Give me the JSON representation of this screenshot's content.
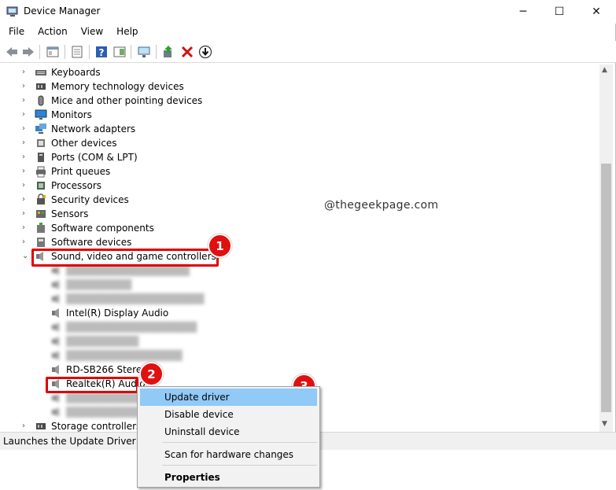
{
  "window": {
    "title": "Device Manager",
    "minimize_glyph": "─",
    "maximize_glyph": "☐",
    "close_glyph": "✕"
  },
  "menu": [
    "File",
    "Action",
    "View",
    "Help"
  ],
  "tree": {
    "items": [
      {
        "label": "Keyboards",
        "icon": "keyboard-icon",
        "expanded": false
      },
      {
        "label": "Memory technology devices",
        "icon": "memory-icon",
        "expanded": false
      },
      {
        "label": "Mice and other pointing devices",
        "icon": "mouse-icon",
        "expanded": false
      },
      {
        "label": "Monitors",
        "icon": "monitor-icon",
        "expanded": false
      },
      {
        "label": "Network adapters",
        "icon": "network-icon",
        "expanded": false
      },
      {
        "label": "Other devices",
        "icon": "unknown-device-icon",
        "expanded": false
      },
      {
        "label": "Ports (COM & LPT)",
        "icon": "port-icon",
        "expanded": false
      },
      {
        "label": "Print queues",
        "icon": "printer-icon",
        "expanded": false
      },
      {
        "label": "Processors",
        "icon": "processor-icon",
        "expanded": false
      },
      {
        "label": "Security devices",
        "icon": "security-icon",
        "expanded": false
      },
      {
        "label": "Sensors",
        "icon": "sensor-icon",
        "expanded": false
      },
      {
        "label": "Software components",
        "icon": "software-component-icon",
        "expanded": false
      },
      {
        "label": "Software devices",
        "icon": "software-device-icon",
        "expanded": false
      },
      {
        "label": "Sound, video and game controllers",
        "icon": "speaker-icon",
        "expanded": true
      }
    ],
    "sound_children": [
      {
        "label": "Intel(R) Display Audio",
        "blurred": false
      },
      {
        "label": "RD-SB266 Stereo",
        "blurred": false
      },
      {
        "label": "Realtek(R) Audio",
        "blurred": false
      }
    ],
    "storage_label": "Storage controllers"
  },
  "status": {
    "text": "Launches the Update Driver Wiza"
  },
  "watermark": "@thegeekpage.com",
  "context_menu": {
    "update": "Update driver",
    "disable": "Disable device",
    "uninstall": "Uninstall device",
    "scan": "Scan for hardware changes",
    "properties": "Properties"
  },
  "badges": [
    "1",
    "2",
    "3"
  ],
  "colors": {
    "highlight": "#e00000",
    "menu_selection": "#91c9f7"
  }
}
